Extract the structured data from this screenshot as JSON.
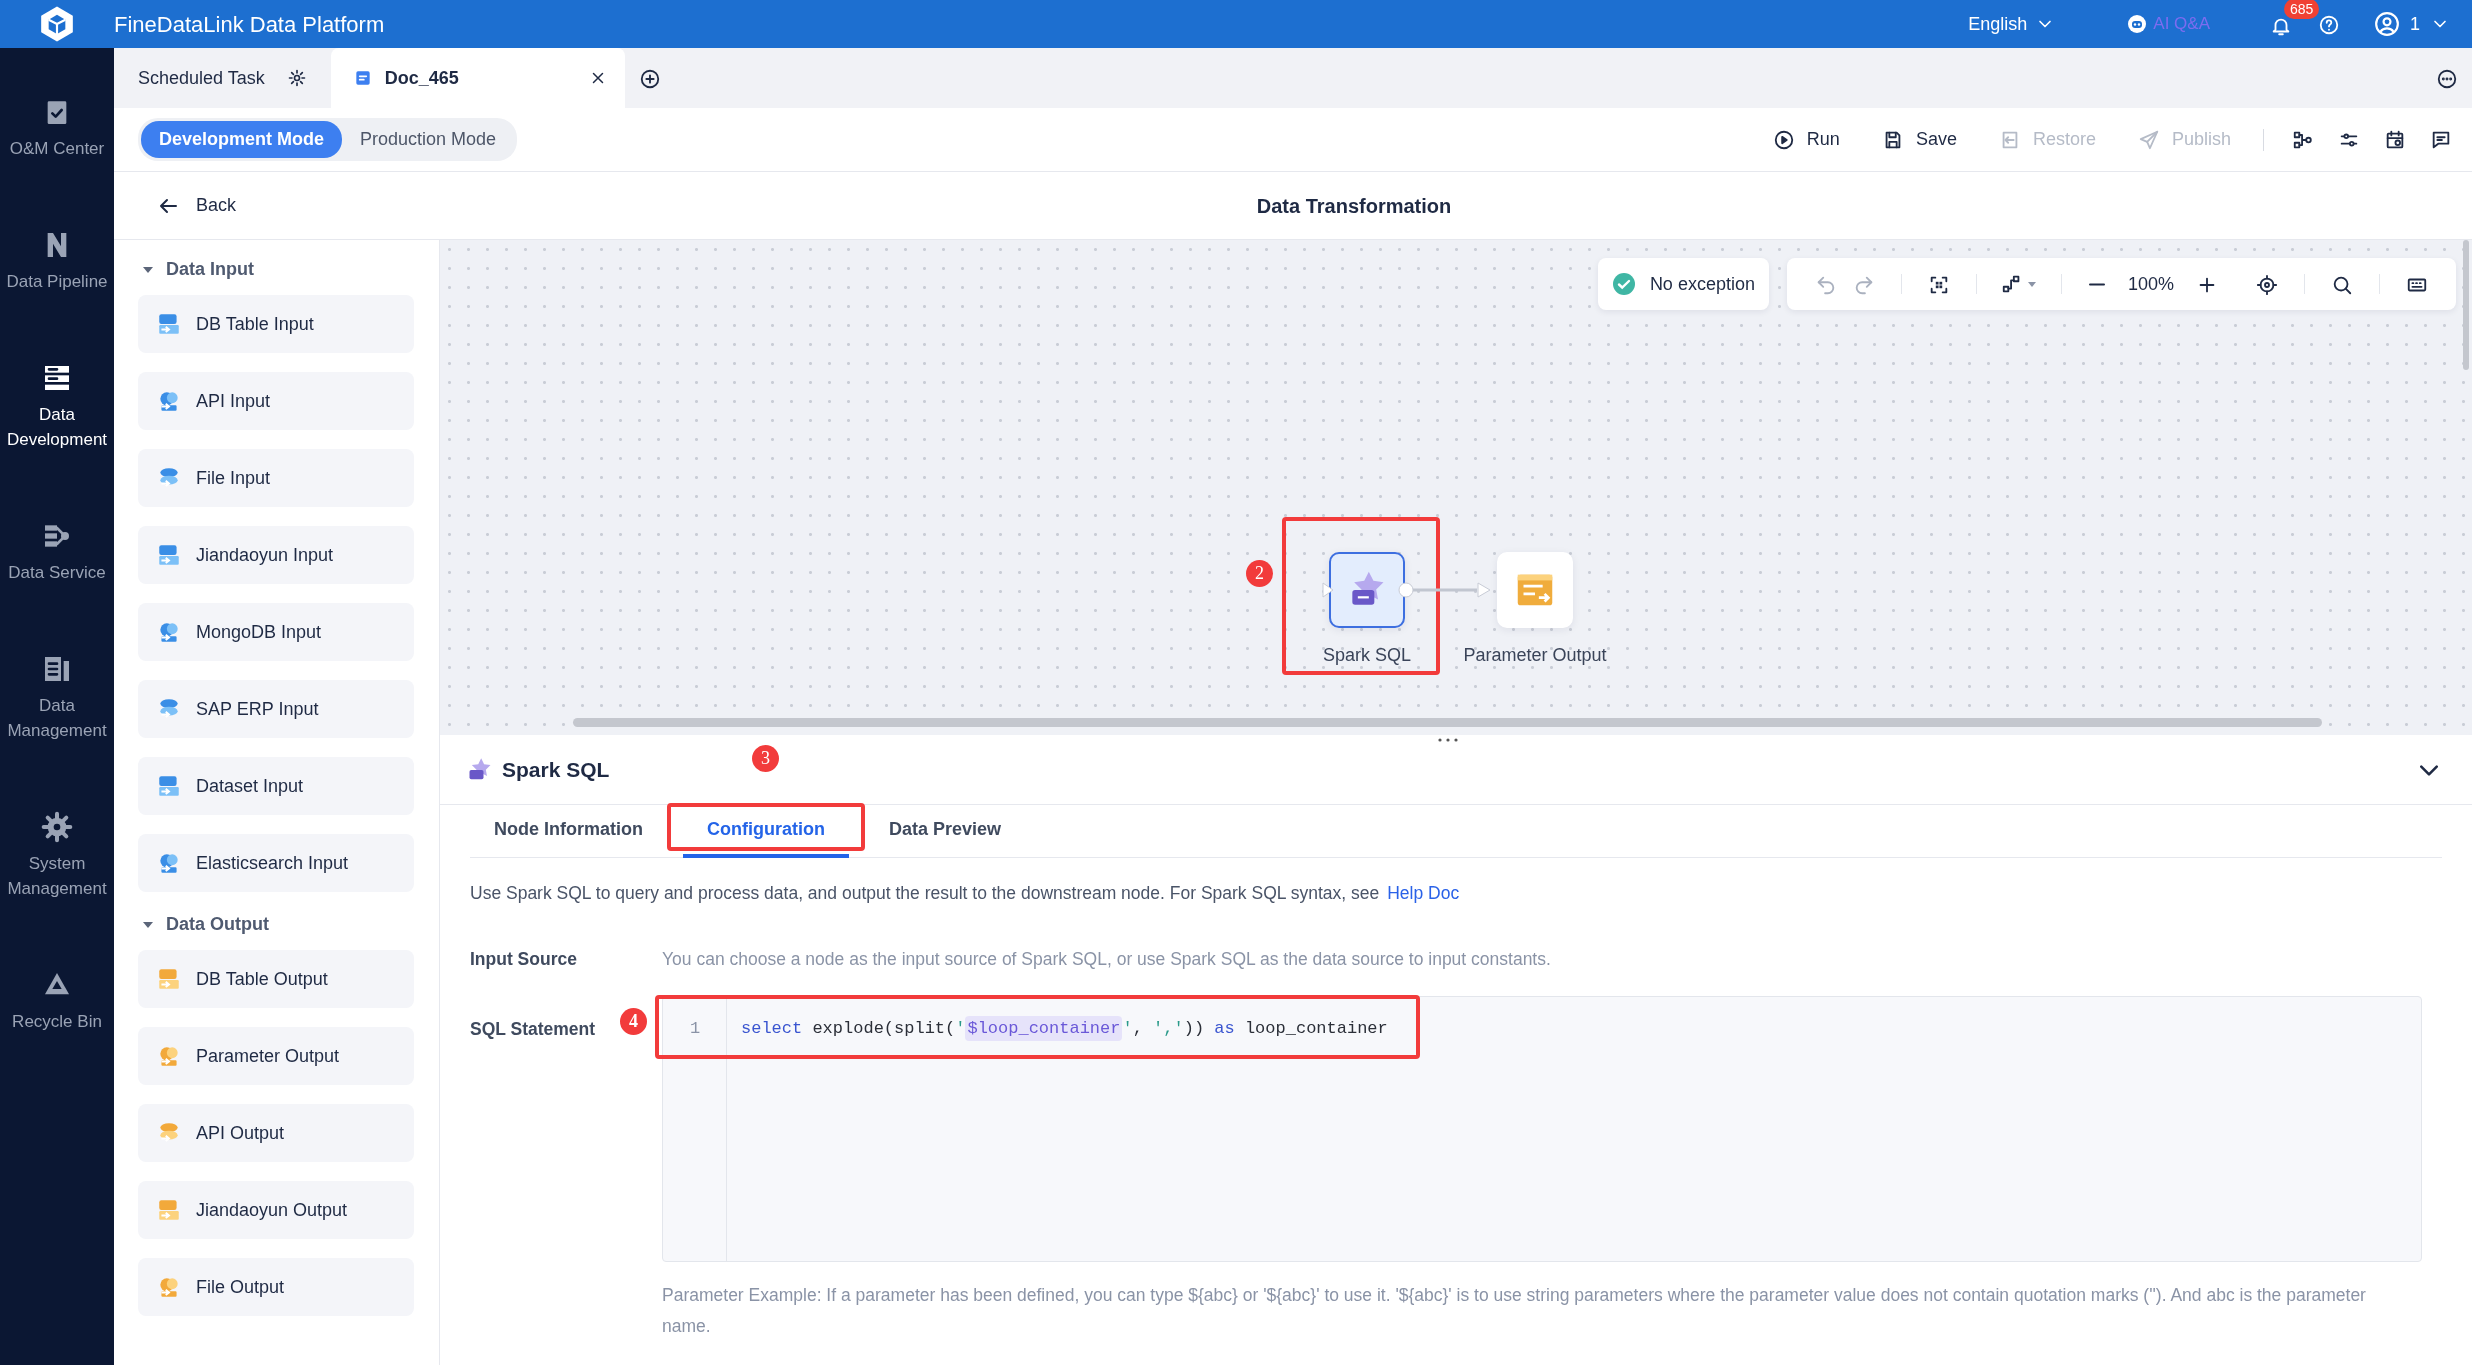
{
  "app": {
    "title": "FineDataLink Data Platform",
    "language": "English",
    "ai_label": "AI Q&A",
    "notification_count": "685",
    "user": "1"
  },
  "nav": [
    {
      "label": "O&M Center",
      "selected": false
    },
    {
      "label": "Data Pipeline",
      "selected": false
    },
    {
      "label": "Data Development",
      "selected": true
    },
    {
      "label": "Data Service",
      "selected": false
    },
    {
      "label": "Data Management",
      "selected": false
    },
    {
      "label": "System Management",
      "selected": false
    },
    {
      "label": "Recycle Bin",
      "selected": false
    }
  ],
  "doc_tabs": [
    {
      "label": "Scheduled Task",
      "selected": false,
      "kind": "settings"
    },
    {
      "label": "Doc_465",
      "selected": true,
      "kind": "document"
    }
  ],
  "modes": [
    {
      "label": "Development Mode",
      "selected": true
    },
    {
      "label": "Production Mode",
      "selected": false
    }
  ],
  "actions": [
    {
      "label": "Run",
      "disabled": false,
      "kind": "run"
    },
    {
      "label": "Save",
      "disabled": false,
      "kind": "save"
    },
    {
      "label": "Restore",
      "disabled": true,
      "kind": "restore"
    },
    {
      "label": "Publish",
      "disabled": true,
      "kind": "publish"
    }
  ],
  "back": "Back",
  "page_title": "Data Transformation",
  "palette": [
    {
      "title": "Data Input",
      "expanded": true,
      "kind": "input",
      "items": [
        "DB Table Input",
        "API Input",
        "File Input",
        "Jiandaoyun Input",
        "MongoDB Input",
        "SAP ERP Input",
        "Dataset Input",
        "Elasticsearch Input"
      ]
    },
    {
      "title": "Data Output",
      "expanded": true,
      "kind": "output",
      "items": [
        "DB Table Output",
        "Parameter Output",
        "API Output",
        "Jiandaoyun Output",
        "File Output"
      ]
    }
  ],
  "canvas": {
    "status": "No exception",
    "zoom": "100%",
    "nodes": [
      {
        "label": "Spark SQL",
        "selected": true,
        "kind": "transform",
        "callout": "2"
      },
      {
        "label": "Parameter Output",
        "selected": false,
        "kind": "output"
      }
    ]
  },
  "panel": {
    "title": "Spark SQL",
    "expanded": true,
    "tabs": [
      {
        "label": "Node Information",
        "selected": false
      },
      {
        "label": "Configuration",
        "selected": true,
        "callout": "3"
      },
      {
        "label": "Data Preview",
        "selected": false
      }
    ],
    "intro": "Use Spark SQL to query and process data, and output the result to the downstream node. For Spark SQL syntax, see",
    "help_link": "Help Doc",
    "input_source": {
      "label": "Input Source",
      "text": "You can choose a node as the input source of Spark SQL, or use Spark SQL as the data source to input constants."
    },
    "sql": {
      "label": "SQL Statement",
      "callout": "4",
      "lines": [
        {
          "number": "1",
          "tokens": [
            {
              "kind": "keyword",
              "text": "select"
            },
            {
              "kind": "plain",
              "text": " explode(split("
            },
            {
              "kind": "string",
              "text": "'"
            },
            {
              "kind": "variable",
              "text": "$loop_container"
            },
            {
              "kind": "string",
              "text": "'"
            },
            {
              "kind": "plain",
              "text": ", "
            },
            {
              "kind": "string",
              "text": "','"
            },
            {
              "kind": "plain",
              "text": ")) "
            },
            {
              "kind": "keyword",
              "text": "as"
            },
            {
              "kind": "plain",
              "text": " loop_container"
            }
          ]
        }
      ]
    },
    "hint": "Parameter Example: If a parameter has been defined, you can type ${abc} or '${abc}' to use it. '${abc}' is to use string parameters where the parameter value does not contain quotation marks (''). And abc is the parameter name."
  }
}
